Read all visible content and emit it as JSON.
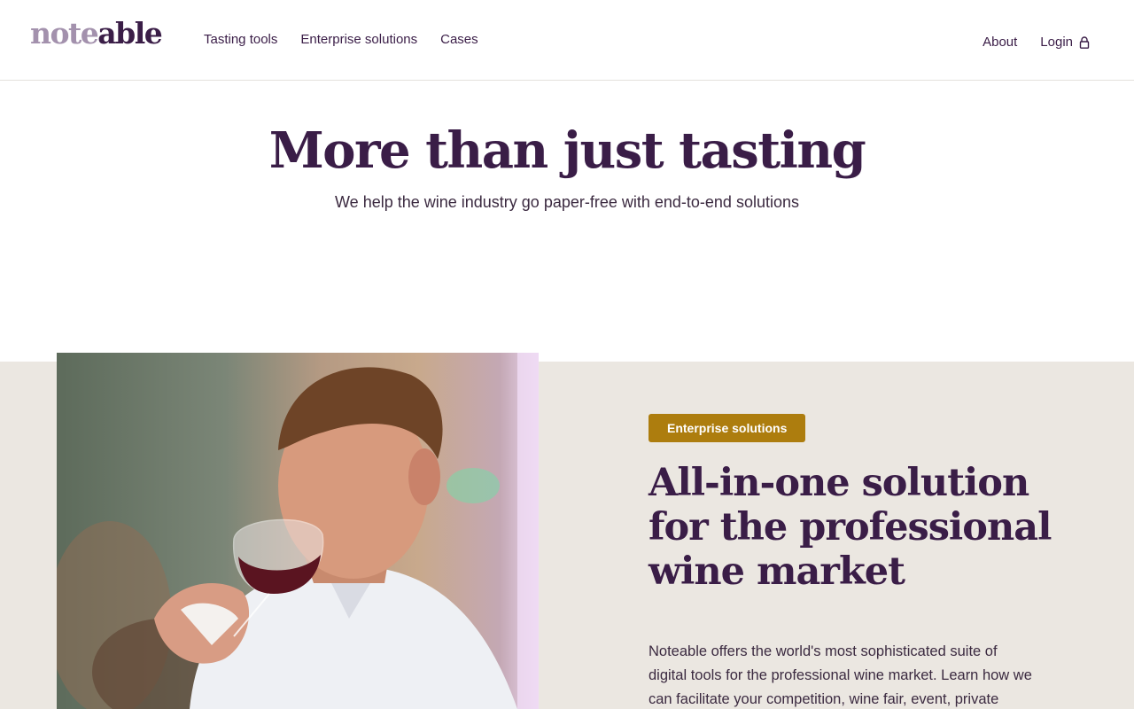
{
  "brand": {
    "logo_part1": "note",
    "logo_part2": "able"
  },
  "nav": {
    "left": [
      "Tasting tools",
      "Enterprise solutions",
      "Cases"
    ],
    "about": "About",
    "login": "Login"
  },
  "hero": {
    "title": "More than just tasting",
    "subtitle": "We help the wine industry go paper-free with end-to-end solutions"
  },
  "feature": {
    "badge": "Enterprise solutions",
    "title": "All-in-one solution for the professional wine market",
    "body": "Noteable offers the world's most sophisticated suite of digital tools for the professional wine market. Learn how we can facilitate your competition, wine fair, event, private"
  },
  "colors": {
    "brand_purple": "#3a1d47",
    "logo_light": "#a391ad",
    "badge_gold": "#ad7d0e",
    "section_bg": "#ebe7e1"
  }
}
